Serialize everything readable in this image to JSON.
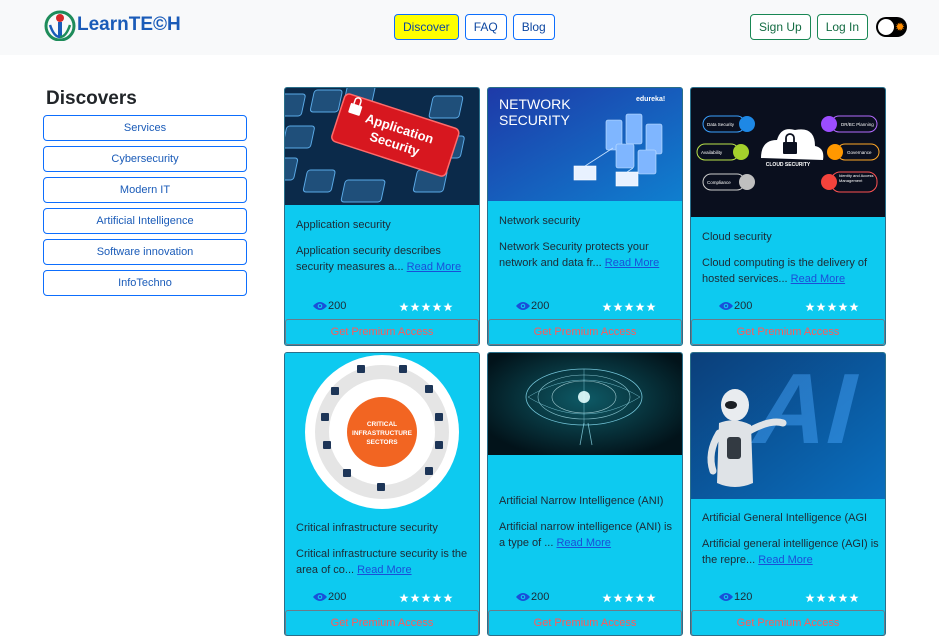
{
  "brand": {
    "name": "LearnTE©H"
  },
  "nav": {
    "items": [
      "Discover",
      "FAQ",
      "Blog"
    ]
  },
  "auth": {
    "signup": "Sign Up",
    "login": "Log In"
  },
  "sidebar": {
    "title": "Discovers",
    "items": [
      "Services",
      "Cybersecurity",
      "Modern IT",
      "Artificial Intelligence",
      "Software innovation",
      "InfoTechno"
    ]
  },
  "cards": [
    {
      "title": "Application security",
      "desc": "Application security describes security measures a...",
      "read_more": "Read More",
      "views": "200",
      "premium": "Get Premium Access",
      "image_text": [
        "Application",
        "Security"
      ]
    },
    {
      "title": "Network security",
      "desc": "Network Security protects your network and data fr...",
      "read_more": "Read More",
      "views": "200",
      "premium": "Get Premium Access",
      "image_text": [
        "NETWORK",
        "SECURITY",
        "edureka!"
      ]
    },
    {
      "title": "Cloud security",
      "desc": "Cloud computing is the delivery of hosted services...",
      "read_more": "Read More",
      "views": "200",
      "premium": "Get Premium Access",
      "image_text": [
        "CLOUD SECURITY",
        "Data Security",
        "Availability",
        "Compliance",
        "DR/BC Planning",
        "Governance",
        "Identity and Access Management"
      ]
    },
    {
      "title": "Critical infrastructure security",
      "desc": "Critical infrastructure security is the area of co...",
      "read_more": "Read More",
      "views": "200",
      "premium": "Get Premium Access",
      "image_text": [
        "CRITICAL",
        "INFRASTRUCTURE",
        "SECTORS"
      ]
    },
    {
      "title": "Artificial Narrow Intelligence (ANI)",
      "desc": "Artificial narrow intelligence (ANI) is a type of ...",
      "read_more": "Read More",
      "views": "200",
      "premium": "Get Premium Access"
    },
    {
      "title": "Artificial General Intelligence (AGI",
      "desc": "Artificial general intelligence (AGI) is the repre...",
      "read_more": "Read More",
      "views": "120",
      "premium": "Get Premium Access",
      "image_text": [
        "AI"
      ]
    }
  ],
  "rating": {
    "stars": 5
  },
  "colors": {
    "card": "#0dcaf0",
    "accent": "#ffff00",
    "brand": "#1a5bb8"
  }
}
